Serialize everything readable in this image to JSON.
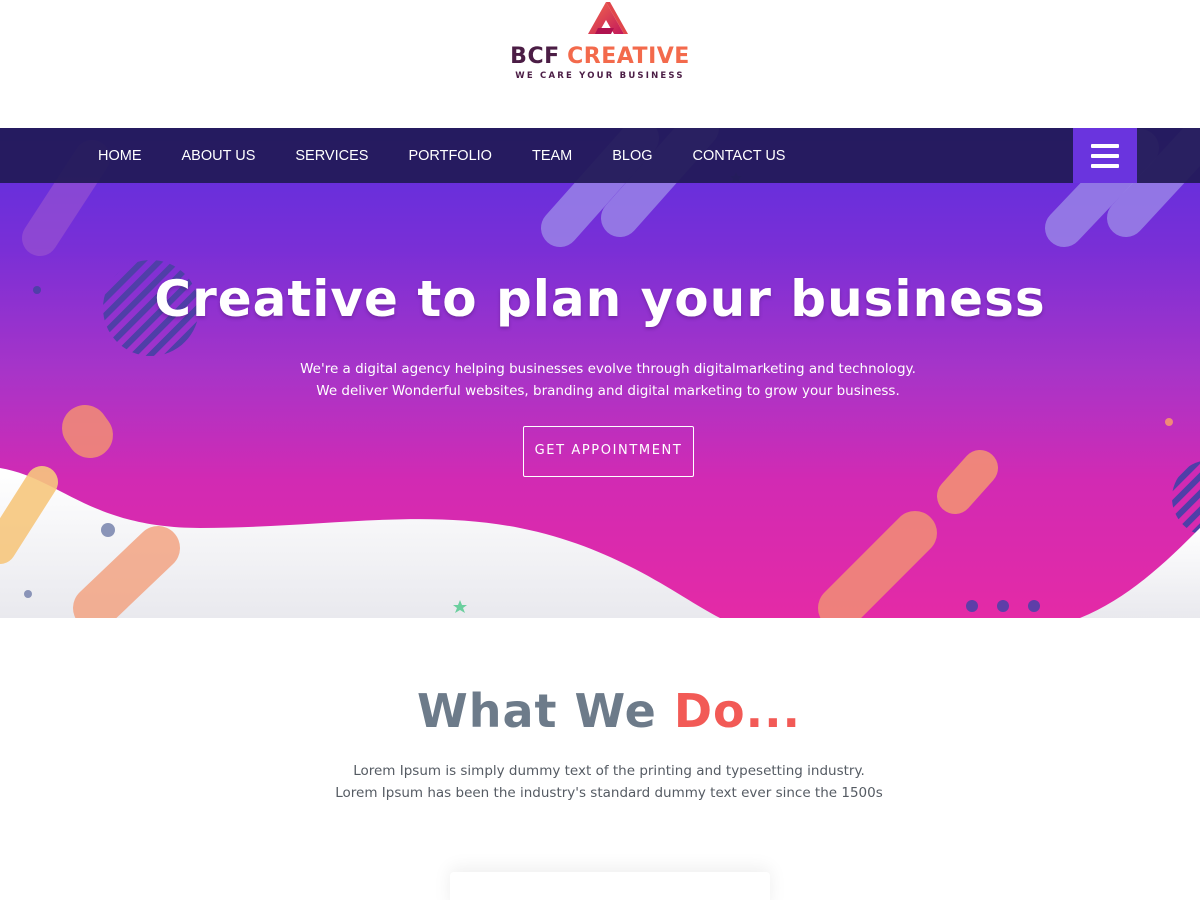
{
  "brand": {
    "name_part1": "BCF",
    "name_part2": "CREATIVE",
    "tagline": "WE CARE YOUR BUSINESS",
    "colors": {
      "dark": "#4b1d45",
      "accent": "#f36a4c"
    }
  },
  "nav": {
    "items": [
      {
        "label": "HOME"
      },
      {
        "label": "ABOUT US"
      },
      {
        "label": "SERVICES"
      },
      {
        "label": "PORTFOLIO"
      },
      {
        "label": "TEAM"
      },
      {
        "label": "BLOG"
      },
      {
        "label": "CONTACT US"
      }
    ],
    "menu_icon": "hamburger-menu-icon"
  },
  "hero": {
    "title": "Creative to plan your business",
    "subtitle_line1": "We're a digital agency helping businesses evolve through digitalmarketing and technology.",
    "subtitle_line2": "We deliver Wonderful websites, branding and digital marketing to grow your business.",
    "cta_label": "GET APPOINTMENT",
    "colors": {
      "top": "#5b2fe0",
      "bottom": "#e42aa6"
    }
  },
  "what_we_do": {
    "title_part1": "What We",
    "title_part2": "Do...",
    "line1": "Lorem Ipsum is simply dummy text of the printing and typesetting industry.",
    "line2": "Lorem Ipsum has been the industry's standard dummy text ever since the 1500s",
    "colors": {
      "title": "#6d7b8a",
      "accent": "#f25a56"
    }
  }
}
